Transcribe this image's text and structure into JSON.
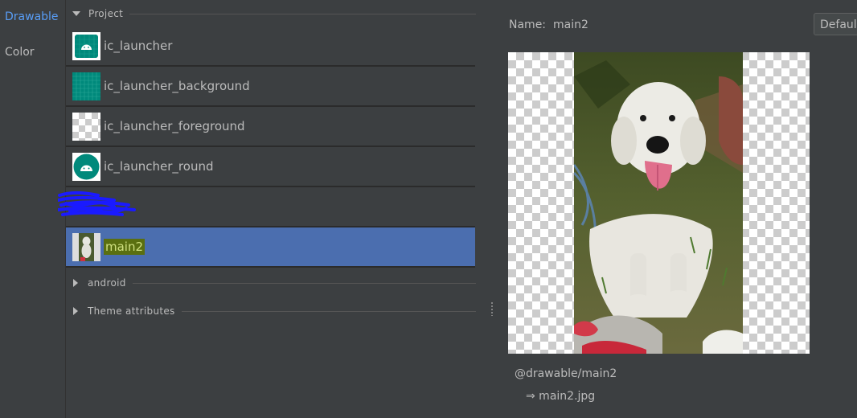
{
  "nav": {
    "items": [
      {
        "label": "Drawable",
        "active": true
      },
      {
        "label": "Color",
        "active": false
      }
    ]
  },
  "groups": {
    "project": "Project",
    "android": "android",
    "theme": "Theme attributes"
  },
  "resources": [
    {
      "name": "ic_launcher",
      "icon": "android-launcher-icon"
    },
    {
      "name": "ic_launcher_background",
      "icon": "grid-background-icon"
    },
    {
      "name": "ic_launcher_foreground",
      "icon": "transparent-foreground-icon"
    },
    {
      "name": "ic_launcher_round",
      "icon": "android-round-icon"
    },
    {
      "name": "",
      "icon": "redacted-scribble"
    },
    {
      "name": "main2",
      "icon": "dog-photo-thumbnail",
      "selected": true
    }
  ],
  "detail": {
    "name_label": "Name:",
    "name_value": "main2",
    "density": "Default",
    "path": "@drawable/main2",
    "file": "⇒ main2.jpg"
  },
  "colors": {
    "accent": "#589df6",
    "selection": "#4b6eaf",
    "teal": "#00897b",
    "scribble": "#1a1aff"
  }
}
